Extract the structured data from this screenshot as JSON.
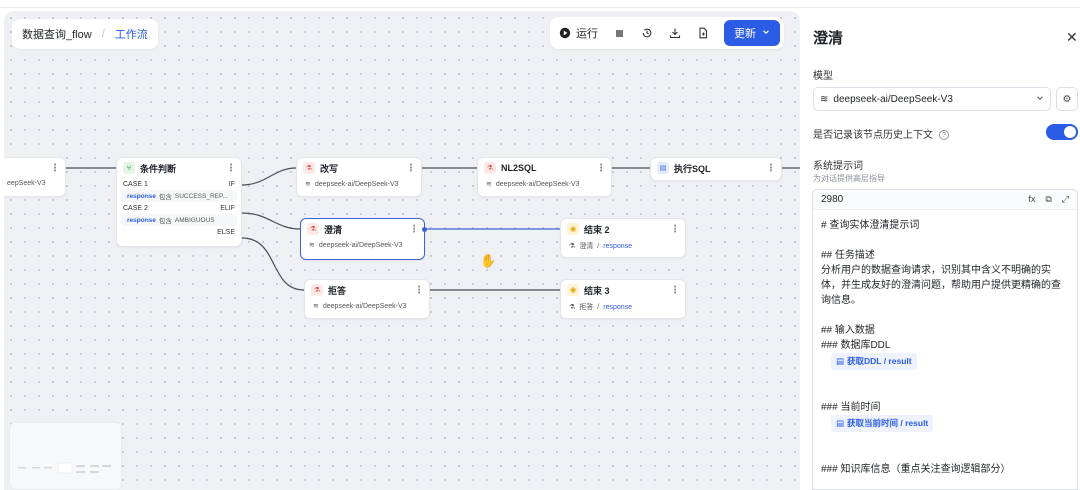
{
  "breadcrumb": {
    "flow_name": "数据查询_flow",
    "tab": "工作流"
  },
  "toolbar": {
    "run_label": "运行",
    "update_label": "更新"
  },
  "nodes": {
    "partial": {
      "model": "eepSeek-V3"
    },
    "condition": {
      "title": "条件判断",
      "case1": "CASE 1",
      "if": "IF",
      "case1_var": "response",
      "case1_op": "包含",
      "case1_val": "SUCCESS_REP...",
      "case2": "CASE 2",
      "elif": "ELIF",
      "case2_var": "response",
      "case2_op": "包含",
      "case2_val": "AMBIGUOUS",
      "else": "ELSE"
    },
    "rewrite": {
      "title": "改写",
      "model": "deepseek-ai/DeepSeek-V3"
    },
    "nl2sql": {
      "title": "NL2SQL",
      "model": "deepseek-ai/DeepSeek-V3"
    },
    "exec_sql": {
      "title": "执行SQL"
    },
    "clarify": {
      "title": "澄清",
      "model": "deepseek-ai/DeepSeek-V3"
    },
    "end2": {
      "title": "结束 2",
      "source": "澄清",
      "var": "response"
    },
    "refuse": {
      "title": "拒答",
      "model": "deepseek-ai/DeepSeek-V3"
    },
    "end3": {
      "title": "结束 3",
      "source": "拒答",
      "var": "response"
    }
  },
  "panel": {
    "title": "澄清",
    "model_label": "模型",
    "model_value": "deepseek-ai/DeepSeek-V3",
    "history_label": "是否记录该节点历史上下文",
    "history_enabled": true,
    "prompt_label": "系统提示词",
    "prompt_sub": "为对话提供高层指导",
    "token_count": "2980",
    "editor_tools": [
      "fx",
      "copy",
      "expand"
    ],
    "prompt_lines": {
      "l1": "# 查询实体澄清提示词",
      "l2": "## 任务描述",
      "l3": "分析用户的数据查询请求，识别其中含义不明确的实体，并生成友好的澄清问题，帮助用户提供更精确的查询信息。",
      "l4": "## 输入数据",
      "l5": "### 数据库DDL",
      "v1": "获取DDL / result",
      "l6": "### 当前时间",
      "v2": "获取当前时间 / result",
      "l7": "### 知识库信息（重点关注查询逻辑部分）"
    }
  },
  "colors": {
    "accent": "#2b5ce6",
    "canvas_bg": "#eef0f4"
  }
}
